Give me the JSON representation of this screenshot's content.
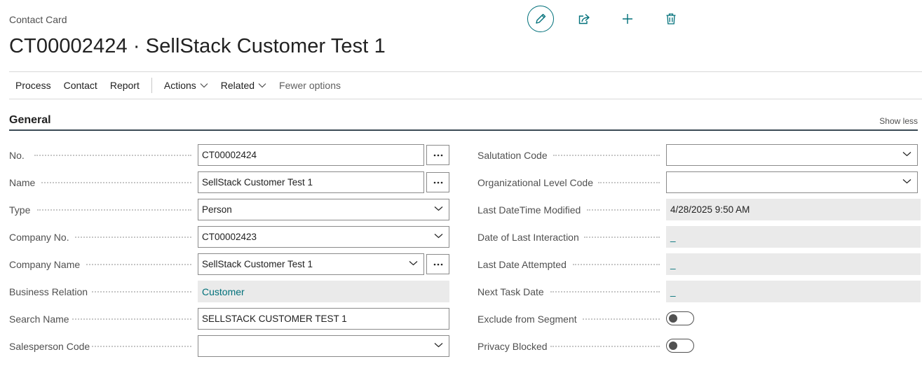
{
  "header": {
    "subtitle": "Contact Card",
    "title": "CT00002424 · SellStack Customer Test 1"
  },
  "toolbar_icons": [
    "edit-icon",
    "share-icon",
    "add-icon",
    "delete-icon"
  ],
  "actionbar": {
    "process": "Process",
    "contact": "Contact",
    "report": "Report",
    "actions": "Actions",
    "related": "Related",
    "fewer_options": "Fewer options"
  },
  "section": {
    "title": "General",
    "toggle": "Show less"
  },
  "left_fields": {
    "no": {
      "label": "No.",
      "value": "CT00002424"
    },
    "name": {
      "label": "Name",
      "value": "SellStack Customer Test 1"
    },
    "type": {
      "label": "Type",
      "value": "Person"
    },
    "company_no": {
      "label": "Company No.",
      "value": "CT00002423"
    },
    "company_name": {
      "label": "Company Name",
      "value": "SellStack Customer Test 1"
    },
    "business_relation": {
      "label": "Business Relation",
      "value": "Customer"
    },
    "search_name": {
      "label": "Search Name",
      "value": "SELLSTACK CUSTOMER TEST 1"
    },
    "salesperson_code": {
      "label": "Salesperson Code",
      "value": ""
    }
  },
  "right_fields": {
    "salutation_code": {
      "label": "Salutation Code",
      "value": ""
    },
    "org_level_code": {
      "label": "Organizational Level Code",
      "value": ""
    },
    "last_modified": {
      "label": "Last DateTime Modified",
      "value": "4/28/2025 9:50 AM"
    },
    "last_interaction": {
      "label": "Date of Last Interaction",
      "value": "_"
    },
    "last_attempted": {
      "label": "Last Date Attempted",
      "value": "_"
    },
    "next_task": {
      "label": "Next Task Date",
      "value": "_"
    },
    "exclude_segment": {
      "label": "Exclude from Segment",
      "on": false
    },
    "privacy_blocked": {
      "label": "Privacy Blocked",
      "on": false
    }
  },
  "colors": {
    "accent": "#00707a",
    "readonly_bg": "#eaeaea",
    "section_rule": "#3b4a55"
  }
}
